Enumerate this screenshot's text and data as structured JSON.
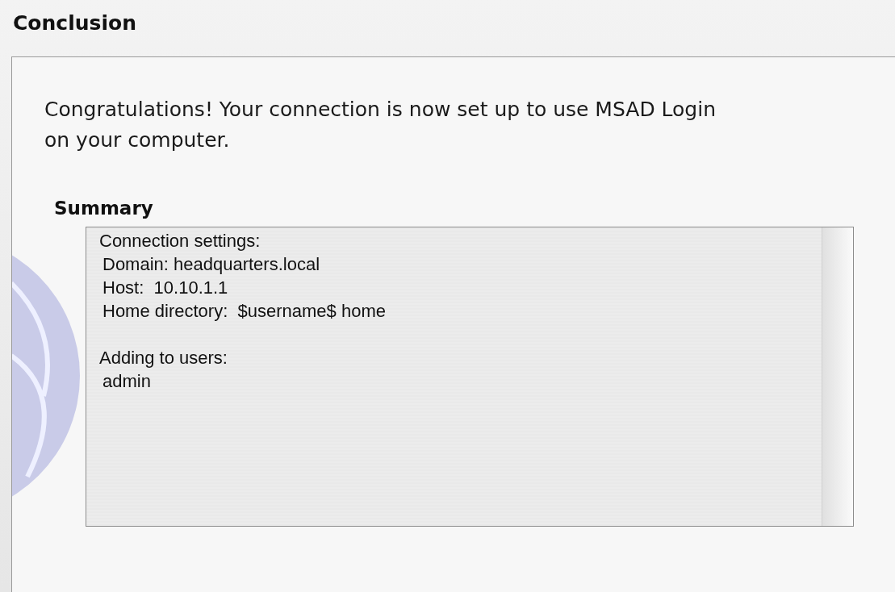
{
  "title": "Conclusion",
  "message": "Congratulations! Your connection is now set up to use MSAD Login on your computer.",
  "summary": {
    "heading": "Summary",
    "groups": [
      {
        "heading": "Connection settings:",
        "items": [
          "Domain: headquarters.local",
          "Host:  10.10.1.1",
          "Home directory:  $username$ home"
        ]
      },
      {
        "heading": "Adding to users:",
        "items": [
          "admin"
        ]
      }
    ]
  }
}
